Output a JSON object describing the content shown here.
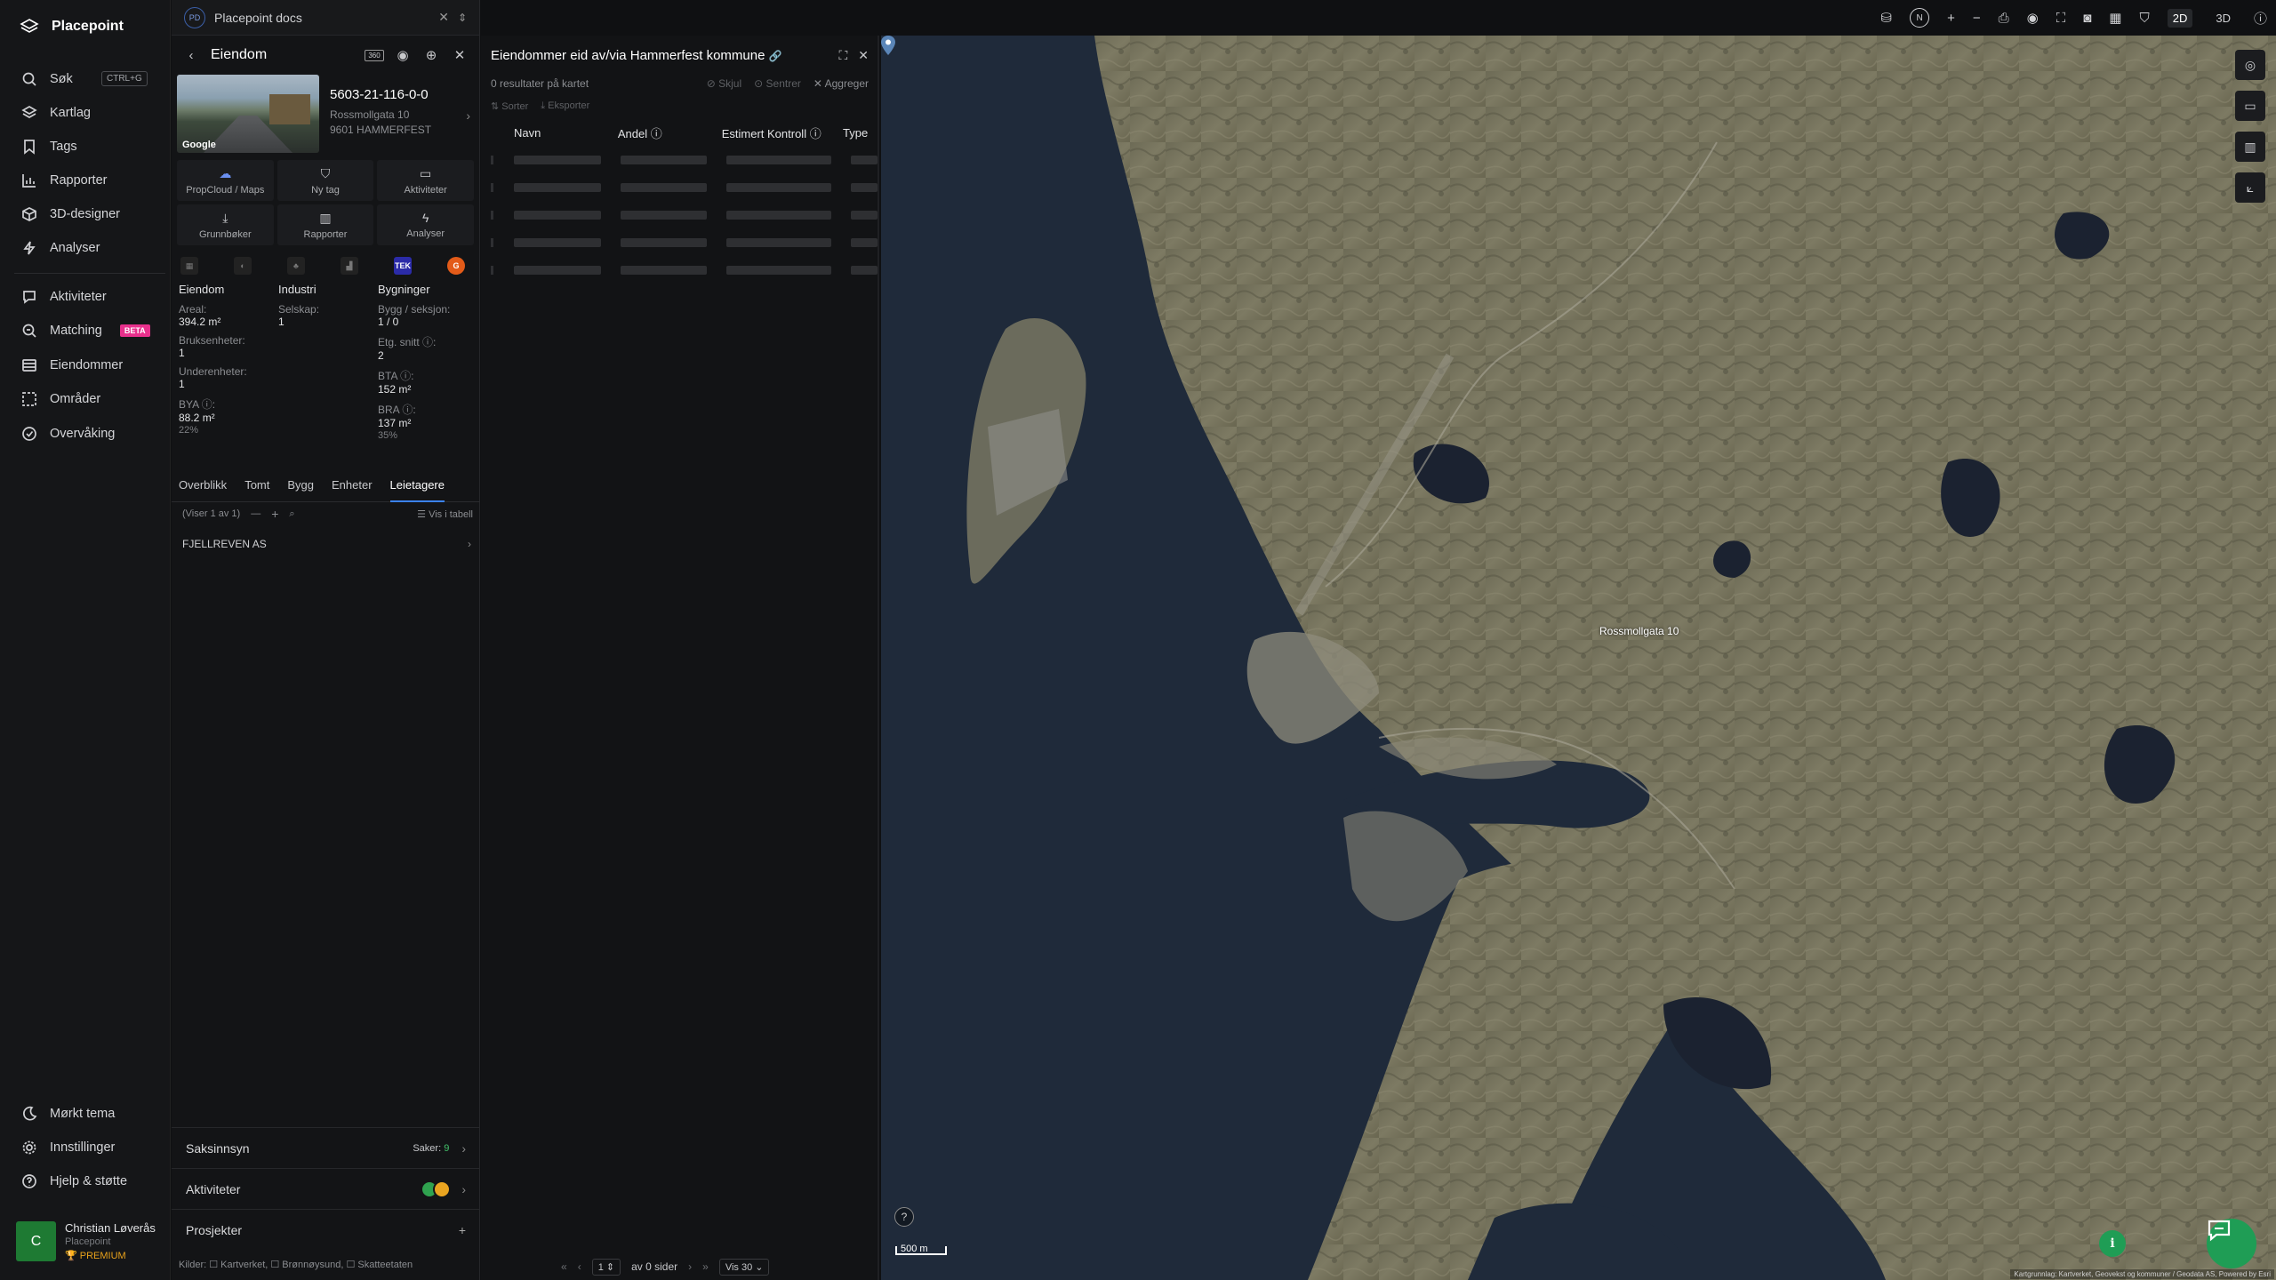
{
  "app": {
    "name": "Placepoint"
  },
  "nav": {
    "search": {
      "label": "Søk",
      "shortcut": "CTRL+G"
    },
    "items_top": [
      "Kartlag",
      "Tags",
      "Rapporter",
      "3D-designer",
      "Analyser"
    ],
    "items_mid": [
      "Aktiviteter",
      "Matching",
      "Eiendommer",
      "Områder",
      "Overvåking"
    ],
    "matching_badge": "BETA",
    "items_bottom": [
      "Mørkt tema",
      "Innstillinger",
      "Hjelp & støtte"
    ]
  },
  "user": {
    "initial": "C",
    "name": "Christian Løverås",
    "org": "Placepoint",
    "tier": "PREMIUM"
  },
  "docs": {
    "icon": "PD",
    "title": "Placepoint docs"
  },
  "property": {
    "header_title": "Eiendom",
    "badge_360": "360",
    "photo_brand": "Google",
    "id": "5603-21-116-0-0",
    "address_line1": "Rossmollgata 10",
    "address_line2": "9601 HAMMERFEST",
    "actions": [
      "PropCloud / Maps",
      "Ny tag",
      "Aktiviteter",
      "Grunnbøker",
      "Rapporter",
      "Analyser"
    ],
    "source_tek": "TEK",
    "source_g": "G",
    "stats": {
      "col1_title": "Eiendom",
      "areal_label": "Areal:",
      "areal_value": "394.2 m²",
      "bruksenheter_label": "Bruksenheter:",
      "bruksenheter_value": "1",
      "underenheter_label": "Underenheter:",
      "underenheter_value": "1",
      "bya_label": "BYA ⓘ:",
      "bya_value": "88.2 m²",
      "bya_pct": "22%",
      "col2_title": "Industri",
      "selskap_label": "Selskap:",
      "selskap_value": "1",
      "col3_title": "Bygninger",
      "bygg_label": "Bygg / seksjon:",
      "bygg_value": "1 / 0",
      "etg_label": "Etg. snitt ⓘ:",
      "etg_value": "2",
      "bta_label": "BTA ⓘ:",
      "bta_value": "152 m²",
      "bra_label": "BRA ⓘ:",
      "bra_value": "137 m²",
      "bra_pct": "35%"
    },
    "tabs": [
      "Overblikk",
      "Tomt",
      "Bygg",
      "Enheter",
      "Leietagere"
    ],
    "list_count": "(Viser 1 av 1)",
    "table_toggle": "Vis i tabell",
    "tenant": "FJELLREVEN AS",
    "accordions": {
      "saksinnsyn": "Saksinnsyn",
      "saker_label": "Saker:",
      "saker_count": "9",
      "aktiviteter": "Aktiviteter",
      "prosjekter": "Prosjekter"
    },
    "sources": "Kilder: ☐ Kartverket, ☐ Brønnøysund, ☐ Skatteetaten"
  },
  "results": {
    "title": "Eiendommer eid av/via Hammerfest kommune",
    "count_text": "0 resultater på kartet",
    "hide": "Skjul",
    "center": "Sentrer",
    "aggregate": "Aggreger",
    "sort": "Sorter",
    "export": "Eksporter",
    "columns": [
      "Navn",
      "Andel ⓘ",
      "Estimert Kontroll ⓘ",
      "Type"
    ],
    "pager": {
      "page": "1",
      "of_pages": "av 0 sider",
      "per_page": "Vis 30"
    }
  },
  "map": {
    "pin_label": "Rossmollgata 10",
    "scale_label": "500 m",
    "view_2d": "2D",
    "view_3d": "3D",
    "north": "N",
    "attribution": "Kartgrunnlag: Kartverket, Geovekst og kommuner / Geodata AS, Powered by Esri"
  },
  "colors": {
    "accent": "#3b82f6",
    "brand_green": "#1f9d55",
    "beta": "#e8308c",
    "premium": "#e7a11b"
  }
}
